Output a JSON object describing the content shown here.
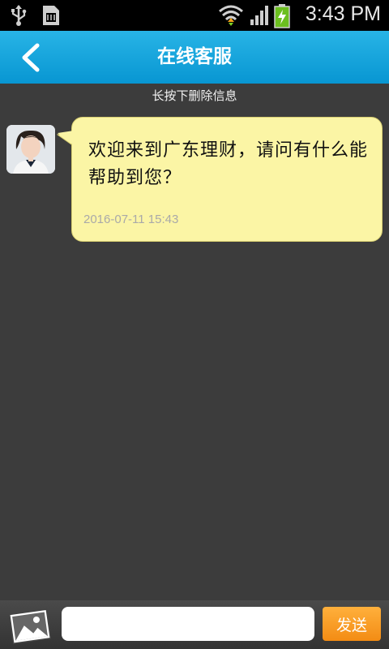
{
  "status_bar": {
    "time": "3:43 PM",
    "icons": [
      "usb-icon",
      "sim-card-icon",
      "wifi-icon",
      "signal-icon",
      "battery-charging-icon"
    ]
  },
  "header": {
    "title": "在线客服",
    "back_icon": "chevron-left-icon"
  },
  "chat": {
    "hint": "长按下删除信息",
    "messages": [
      {
        "sender_avatar": "support-agent-avatar",
        "text": "欢迎来到广东理财，请问有什么能帮助到您？",
        "time": "2016-07-11 15:43"
      }
    ]
  },
  "composer": {
    "image_icon": "image-picker-icon",
    "input_value": "",
    "input_placeholder": "",
    "send_label": "发送"
  },
  "colors": {
    "header": "#10a3db",
    "bubble": "#fbf5a5",
    "send_button": "#f7961e",
    "background": "#3c3c3c"
  }
}
